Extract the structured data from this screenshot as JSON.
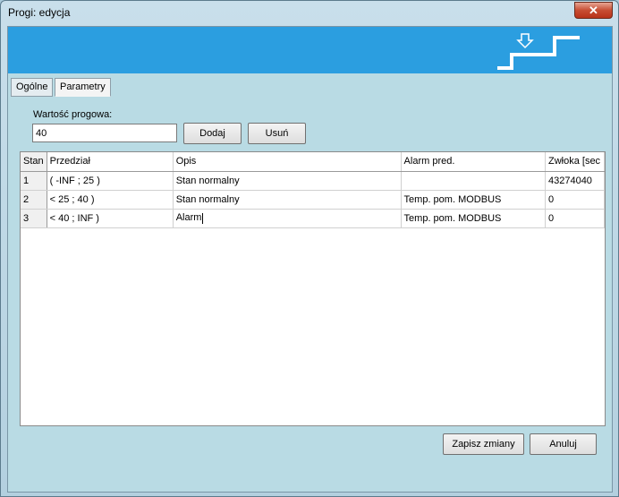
{
  "window": {
    "title": "Progi: edycja",
    "close_glyph": "✕"
  },
  "banner": {
    "icon": "stairs-threshold-icon",
    "color": "#2b9ee0"
  },
  "tabs": [
    {
      "label": "Ogólne",
      "active": false
    },
    {
      "label": "Parametry",
      "active": true
    }
  ],
  "threshold": {
    "label": "Wartość progowa:",
    "value": "40",
    "add_label": "Dodaj",
    "remove_label": "Usuń"
  },
  "table": {
    "columns": [
      "Stan",
      "Przedział",
      "Opis",
      "Alarm pred.",
      "Zwłoka [sec"
    ],
    "rows": [
      [
        "1",
        "( -INF ; 25 )",
        "Stan normalny",
        "",
        "43274040"
      ],
      [
        "2",
        "< 25 ; 40 )",
        "Stan normalny",
        "Temp. pom. MODBUS",
        "0"
      ],
      [
        "3",
        "< 40 ; INF )",
        "Alarm",
        "Temp. pom. MODBUS",
        "0"
      ]
    ]
  },
  "footer": {
    "save_label": "Zapisz zmiany",
    "cancel_label": "Anuluj"
  }
}
